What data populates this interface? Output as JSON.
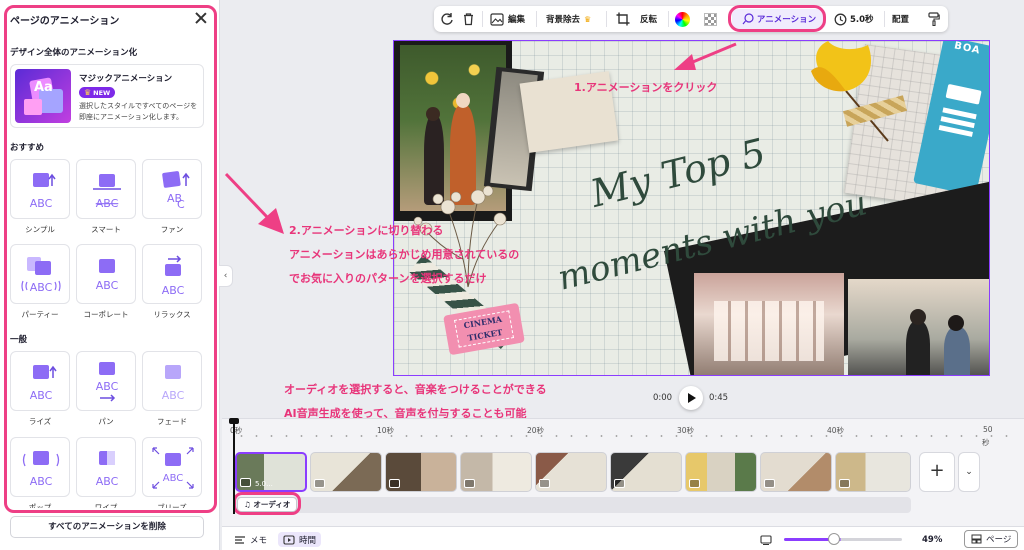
{
  "panel": {
    "title": "ページのアニメーション",
    "design_section": "デザイン全体のアニメーション化",
    "magic": {
      "name": "マジックアニメーション",
      "badge": "NEW",
      "desc": "選択したスタイルですべてのページを即座にアニメーション化します。"
    },
    "recommended_heading": "おすすめ",
    "general_heading": "一般",
    "recommended": [
      "シンプル",
      "スマート",
      "ファン",
      "パーティー",
      "コーポレート",
      "リラックス"
    ],
    "general": [
      "ライズ",
      "パン",
      "フェード",
      "ポップ",
      "ワイプ",
      "ブリーズ"
    ],
    "delete_all": "すべてのアニメーションを削除"
  },
  "toolbar": {
    "edit": "編集",
    "bg_remove": "背景除去",
    "flip": "反転",
    "animation": "アニメーション",
    "duration": "5.0秒",
    "arrange": "配置",
    "icons": [
      "refresh-icon",
      "trash-icon",
      "image-edit-icon",
      "crop-icon",
      "color-wheel-icon",
      "transparency-icon",
      "animation-icon",
      "clock-icon",
      "paint-roller-icon"
    ]
  },
  "slide": {
    "line1": "My Top 5",
    "line2": "moments with you",
    "ticket1": "CINEMA",
    "ticket2": "TICKET",
    "corner": "BOA"
  },
  "annotations": {
    "a1": "1.アニメーションをクリック",
    "a2_line1": "2.アニメーションに切り替わる",
    "a2_line2": "アニメーションはあらかじめ用意されているの",
    "a2_line3": "でお気に入りのパターンを選択するだけ",
    "a3_line1": "オーディオを選択すると、音楽をつけることができる",
    "a3_line2": "AI音声生成を使って、音声を付与することも可能",
    "color": "#e8357a"
  },
  "player": {
    "current": "0:00",
    "total": "0:45"
  },
  "timeline": {
    "ticks": [
      "0秒",
      "10秒",
      "20秒",
      "30秒",
      "40秒",
      "50"
    ],
    "tick_unit_last": "秒",
    "first_clip_duration": "5.0...",
    "audio_label": "オーディオ",
    "add": "+",
    "expand": "⌄"
  },
  "bottom": {
    "memo": "メモ",
    "time": "時間",
    "zoom": "49%",
    "page": "ページ"
  }
}
